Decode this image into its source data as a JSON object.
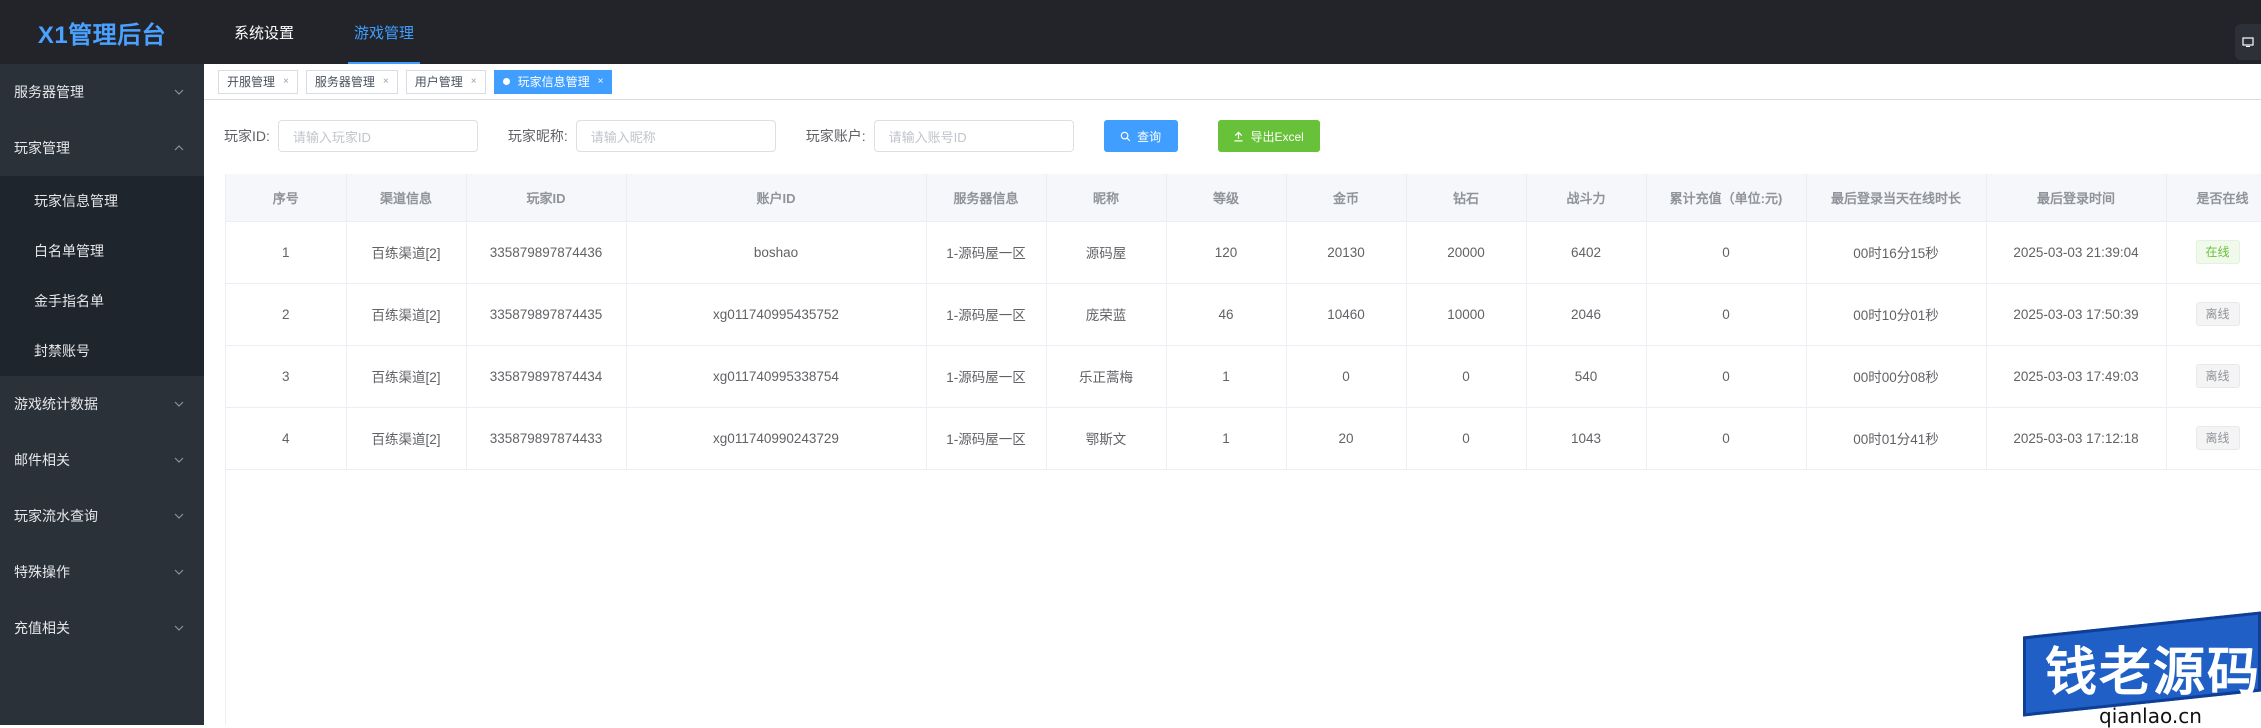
{
  "brand": "X1管理后台",
  "topnav": [
    {
      "label": "系统设置",
      "active": false
    },
    {
      "label": "游戏管理",
      "active": true
    }
  ],
  "sidebar": {
    "items": [
      {
        "label": "服务器管理"
      },
      {
        "label": "玩家管理",
        "expanded": true,
        "children": [
          "玩家信息管理",
          "白名单管理",
          "金手指名单",
          "封禁账号"
        ]
      },
      {
        "label": "游戏统计数据"
      },
      {
        "label": "邮件相关"
      },
      {
        "label": "玩家流水查询"
      },
      {
        "label": "特殊操作"
      },
      {
        "label": "充值相关"
      }
    ]
  },
  "tabs": [
    {
      "label": "开服管理",
      "close": "×"
    },
    {
      "label": "服务器管理",
      "close": "×"
    },
    {
      "label": "用户管理",
      "close": "×"
    },
    {
      "label": "玩家信息管理",
      "close": "×",
      "active": true
    }
  ],
  "filters": {
    "player_id_label": "玩家ID:",
    "player_id_placeholder": "请输入玩家ID",
    "nickname_label": "玩家昵称:",
    "nickname_placeholder": "请输入昵称",
    "account_label": "玩家账户:",
    "account_placeholder": "请输入账号ID",
    "search_label": "查询",
    "export_label": "导出Excel"
  },
  "table": {
    "headers": [
      "序号",
      "渠道信息",
      "玩家ID",
      "账户ID",
      "服务器信息",
      "昵称",
      "等级",
      "金币",
      "钻石",
      "战斗力",
      "累计充值（单位:元)",
      "最后登录当天在线时长",
      "最后登录时间",
      "是否在线"
    ],
    "rows": [
      [
        "1",
        "百练渠道[2]",
        "335879897874436",
        "boshao",
        "1-源码屋一区",
        "源码屋",
        "120",
        "20130",
        "20000",
        "6402",
        "0",
        "00时16分15秒",
        "2025-03-03 21:39:04",
        "在线"
      ],
      [
        "2",
        "百练渠道[2]",
        "335879897874435",
        "xg011740995435752",
        "1-源码屋一区",
        "庞荣蓝",
        "46",
        "10460",
        "10000",
        "2046",
        "0",
        "00时10分01秒",
        "2025-03-03 17:50:39",
        "离线"
      ],
      [
        "3",
        "百练渠道[2]",
        "335879897874434",
        "xg011740995338754",
        "1-源码屋一区",
        "乐正蒿梅",
        "1",
        "0",
        "0",
        "540",
        "0",
        "00时00分08秒",
        "2025-03-03 17:49:03",
        "离线"
      ],
      [
        "4",
        "百练渠道[2]",
        "335879897874433",
        "xg011740990243729",
        "1-源码屋一区",
        "鄂斯文",
        "1",
        "20",
        "0",
        "1043",
        "0",
        "00时01分41秒",
        "2025-03-03 17:12:18",
        "离线"
      ]
    ]
  },
  "watermark": {
    "text": "钱老源码",
    "url": "qianlao.cn"
  },
  "colors": {
    "accent": "#409eff",
    "success": "#67c23a",
    "topbar": "#222429",
    "sidebar": "#2b3139"
  }
}
